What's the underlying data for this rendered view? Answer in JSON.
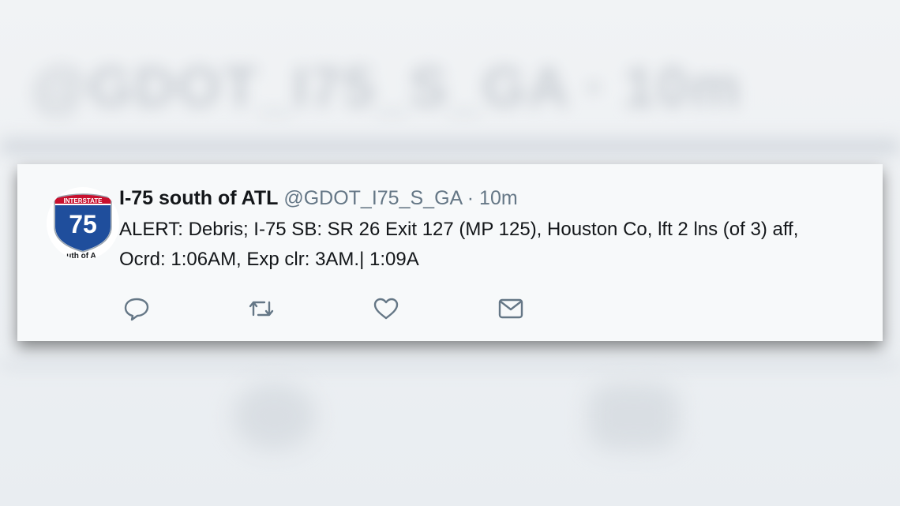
{
  "background": {
    "blurred_text": "@GDOT_I75_S_GA · 10m"
  },
  "tweet": {
    "avatar": {
      "shield_banner": "INTERSTATE",
      "shield_number": "75",
      "caption": "uth of A"
    },
    "name": "I-75 south of ATL",
    "handle": "@GDOT_I75_S_GA",
    "separator": "·",
    "time": "10m",
    "text": "ALERT: Debris; I-75 SB: SR 26 Exit 127 (MP 125), Houston Co, lft 2 lns (of 3) aff,\nOcrd: 1:06AM, Exp clr: 3AM.| 1:09A",
    "actions": [
      {
        "icon": "reply-icon"
      },
      {
        "icon": "retweet-icon"
      },
      {
        "icon": "like-icon"
      },
      {
        "icon": "direct-message-icon"
      }
    ],
    "colors": {
      "text": "#14171a",
      "secondary": "#657786",
      "shield_blue": "#1f4e9c",
      "shield_red": "#c8102e"
    }
  }
}
